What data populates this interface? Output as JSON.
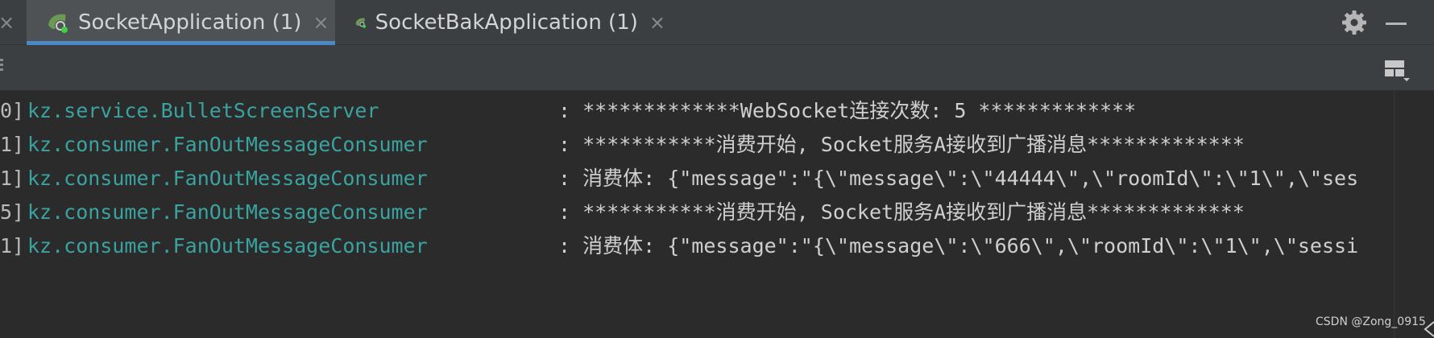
{
  "tabs": [
    {
      "label": "SocketApplication (1)",
      "close": "×",
      "active": true
    },
    {
      "label": "SocketBakApplication (1)",
      "close": "×",
      "active": false
    }
  ],
  "edge_close": "×",
  "icons": {
    "tab_icon": "spring-boot-app-icon",
    "settings": "gear-icon",
    "minimize": "minimize-icon",
    "layout": "layout-icon",
    "grip": "drag-grip-icon"
  },
  "colors": {
    "background": "#2b2b2b",
    "tabbar": "#3c3f41",
    "active_tab": "#4e5254",
    "active_underline": "#4a88c7",
    "logger": "#3aa3a0",
    "message": "#cfcfcf"
  },
  "console": {
    "lines": [
      {
        "prefix": "0]",
        "logger": "kz.service.BulletScreenServer",
        "message": ": *************WebSocket连接次数: 5 *************"
      },
      {
        "prefix": "1]",
        "logger": "kz.consumer.FanOutMessageConsumer",
        "message": ": ***********消费开始, Socket服务A接收到广播消息*************"
      },
      {
        "prefix": "1]",
        "logger": "kz.consumer.FanOutMessageConsumer",
        "message": ": 消费体: {\"message\":\"{\\\"message\\\":\\\"44444\\\",\\\"roomId\\\":\\\"1\\\",\\\"ses"
      },
      {
        "prefix": "5]",
        "logger": "kz.consumer.FanOutMessageConsumer",
        "message": ": ***********消费开始, Socket服务A接收到广播消息*************"
      },
      {
        "prefix": "1]",
        "logger": "kz.consumer.FanOutMessageConsumer",
        "message": ": 消费体: {\"message\":\"{\\\"message\\\":\\\"666\\\",\\\"roomId\\\":\\\"1\\\",\\\"sessi"
      }
    ]
  },
  "watermark": "CSDN @Zong_0915"
}
